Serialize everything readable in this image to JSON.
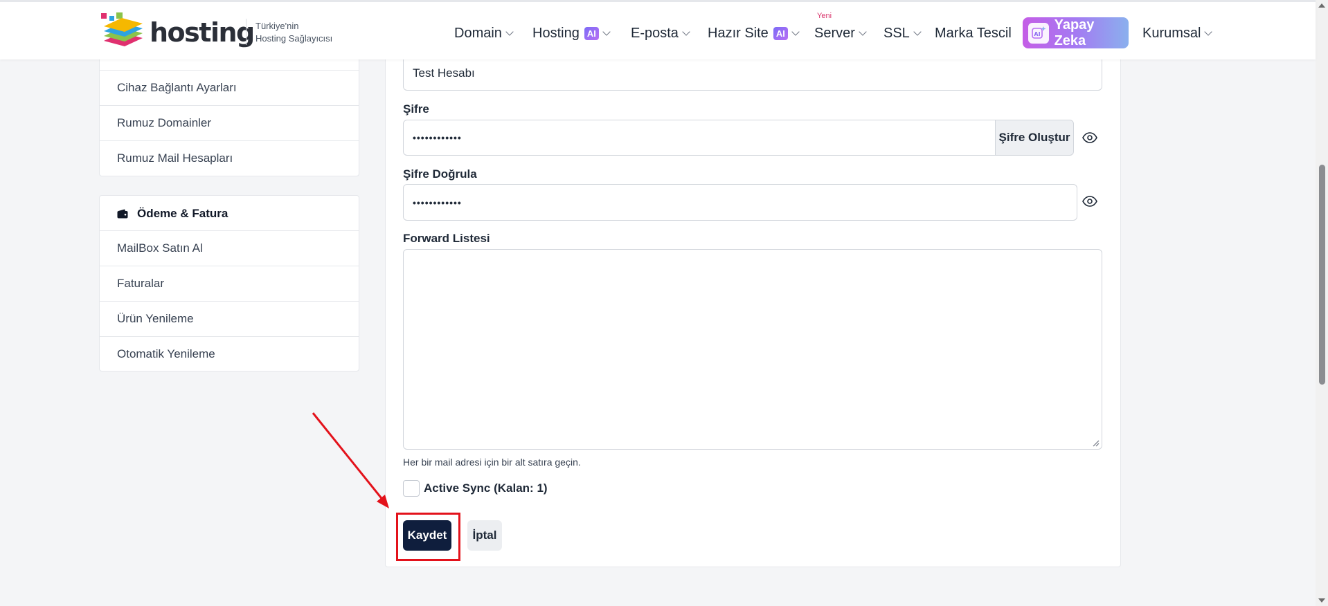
{
  "header": {
    "logo_text": "hosting",
    "tagline_line1": "Türkiye'nin",
    "tagline_line2": "Hosting Sağlayıcısı",
    "nav": {
      "domain": "Domain",
      "hosting": "Hosting",
      "hosting_badge": "AI",
      "eposta": "E-posta",
      "hazir_site": "Hazır Site",
      "hazir_site_badge": "AI",
      "server": "Server",
      "server_tag": "Yeni",
      "ssl": "SSL",
      "marka_tescil": "Marka Tescil",
      "yapay_zeka": "Yapay Zeka",
      "yapay_zeka_icon_text": "AI",
      "kurumsal": "Kurumsal"
    }
  },
  "sidebar": {
    "top_group": {
      "items": [
        {
          "label": "Cihaz Bağlantı Ayarları"
        },
        {
          "label": "Rumuz Domainler"
        },
        {
          "label": "Rumuz Mail Hesapları"
        }
      ]
    },
    "payment_group": {
      "title": "Ödeme & Fatura",
      "icon": "wallet-icon",
      "items": [
        {
          "label": "MailBox Satın Al"
        },
        {
          "label": "Faturalar"
        },
        {
          "label": "Ürün Yenileme"
        },
        {
          "label": "Otomatik Yenileme"
        }
      ]
    }
  },
  "form": {
    "name_value": "Test Hesabı",
    "password_label": "Şifre",
    "password_value": "••••••••••••",
    "generate_password_label": "Şifre Oluştur",
    "confirm_label": "Şifre Doğrula",
    "confirm_value": "••••••••••••",
    "forward_label": "Forward Listesi",
    "forward_value": "",
    "forward_hint": "Her bir mail adresi için bir alt satıra geçin.",
    "active_sync_label": "Active Sync (Kalan: 1)",
    "active_sync_checked": false,
    "save_label": "Kaydet",
    "cancel_label": "İptal"
  },
  "colors": {
    "primary_button": "#0f1e3d",
    "annotation_red": "#e3121b",
    "ai_gradient_start": "#c45de6",
    "ai_gradient_end": "#8ab0ee"
  }
}
